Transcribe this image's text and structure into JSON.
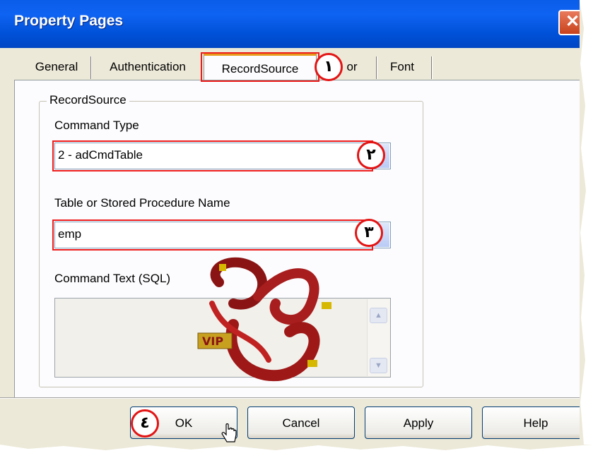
{
  "window": {
    "title": "Property Pages"
  },
  "tabs": [
    {
      "label": "General"
    },
    {
      "label": "Authentication"
    },
    {
      "label": "RecordSource"
    },
    {
      "label": "or"
    },
    {
      "label": "Font"
    }
  ],
  "group": {
    "legend": "RecordSource",
    "command_type_label": "Command Type",
    "command_type_value": "2 - adCmdTable",
    "table_label": "Table or Stored Procedure Name",
    "table_value": "emp",
    "sql_label": "Command Text (SQL)",
    "sql_value": ""
  },
  "markers": {
    "m1": "١",
    "m2": "٢",
    "m3": "٣",
    "m4": "٤"
  },
  "watermark": {
    "text": "VIP"
  },
  "buttons": {
    "ok": "OK",
    "cancel": "Cancel",
    "apply": "Apply",
    "help": "Help"
  },
  "colors": {
    "annotation": "#ee1c1c",
    "titlebar": "#0051d8",
    "watermark": "#8a1414"
  }
}
